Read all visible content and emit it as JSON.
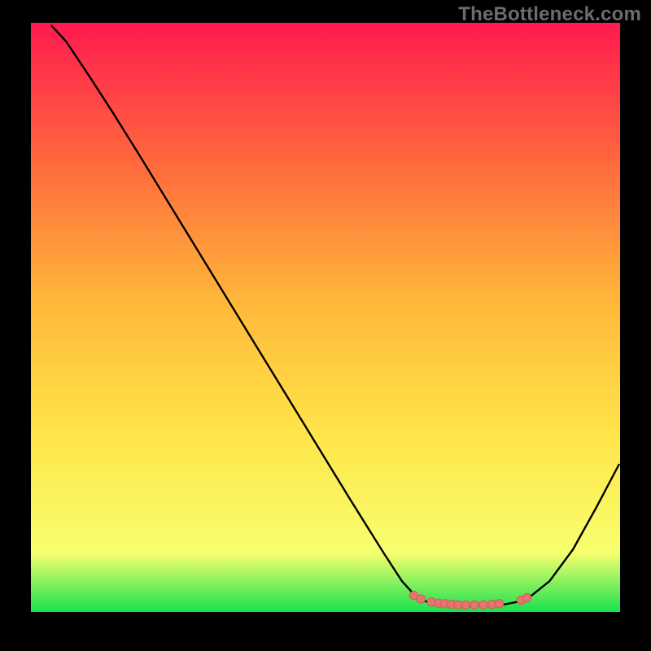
{
  "watermark": "TheBottleneck.com",
  "colors": {
    "bg_black": "#000000",
    "grad_top": "#ff1a4f",
    "grad_mid1": "#ff6a3d",
    "grad_mid2": "#ffb93a",
    "grad_mid3": "#ffe54a",
    "grad_mid4": "#f7ff6e",
    "grad_bottom": "#17e24e",
    "curve": "#000000",
    "marker_fill": "#e4766f",
    "marker_stroke": "#d45b57"
  },
  "chart_data": {
    "type": "line",
    "title": "",
    "xlabel": "",
    "ylabel": "",
    "xlim": [
      0,
      100
    ],
    "ylim": [
      0,
      100
    ],
    "curve": [
      {
        "x": 3.5,
        "y": 99.5
      },
      {
        "x": 6.0,
        "y": 96.8
      },
      {
        "x": 8.0,
        "y": 93.8
      },
      {
        "x": 10.0,
        "y": 90.8
      },
      {
        "x": 14.0,
        "y": 84.6
      },
      {
        "x": 18.0,
        "y": 78.2
      },
      {
        "x": 24.0,
        "y": 68.4
      },
      {
        "x": 30.0,
        "y": 58.6
      },
      {
        "x": 36.0,
        "y": 48.8
      },
      {
        "x": 42.0,
        "y": 39.0
      },
      {
        "x": 48.0,
        "y": 29.2
      },
      {
        "x": 54.0,
        "y": 19.4
      },
      {
        "x": 60.0,
        "y": 9.8
      },
      {
        "x": 63.0,
        "y": 5.2
      },
      {
        "x": 65.0,
        "y": 3.0
      },
      {
        "x": 67.0,
        "y": 1.8
      },
      {
        "x": 70.0,
        "y": 1.2
      },
      {
        "x": 75.0,
        "y": 1.0
      },
      {
        "x": 80.0,
        "y": 1.2
      },
      {
        "x": 83.0,
        "y": 1.8
      },
      {
        "x": 85.0,
        "y": 2.8
      },
      {
        "x": 88.0,
        "y": 5.2
      },
      {
        "x": 92.0,
        "y": 10.6
      },
      {
        "x": 96.0,
        "y": 17.8
      },
      {
        "x": 99.8,
        "y": 25.0
      }
    ],
    "markers": [
      {
        "x": 65.0,
        "y": 2.8
      },
      {
        "x": 66.2,
        "y": 2.2
      },
      {
        "x": 68.0,
        "y": 1.7
      },
      {
        "x": 69.2,
        "y": 1.5
      },
      {
        "x": 70.2,
        "y": 1.4
      },
      {
        "x": 71.4,
        "y": 1.3
      },
      {
        "x": 72.5,
        "y": 1.2
      },
      {
        "x": 73.8,
        "y": 1.2
      },
      {
        "x": 75.3,
        "y": 1.2
      },
      {
        "x": 76.8,
        "y": 1.2
      },
      {
        "x": 78.3,
        "y": 1.3
      },
      {
        "x": 79.5,
        "y": 1.4
      },
      {
        "x": 83.2,
        "y": 2.0
      },
      {
        "x": 84.2,
        "y": 2.4
      }
    ]
  }
}
